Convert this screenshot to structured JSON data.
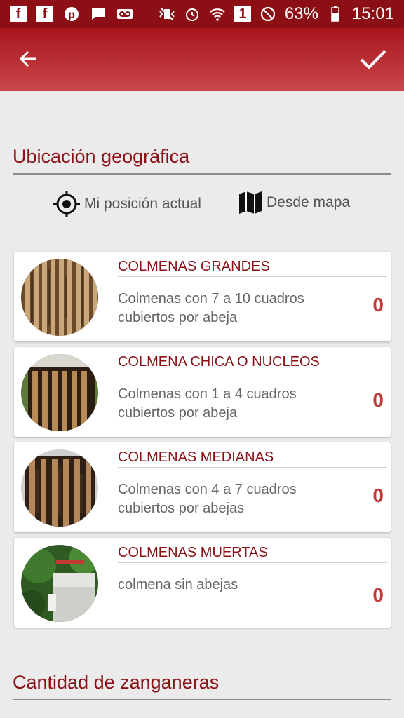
{
  "status_bar": {
    "battery": "63%",
    "time": "15:01",
    "sim": "1"
  },
  "app_bar": {
    "back_icon": "arrow-left-icon",
    "confirm_icon": "check-icon"
  },
  "location": {
    "title": "Ubicación geográfica",
    "current_position_label": "Mi posición actual",
    "from_map_label": "Desde mapa"
  },
  "hives": [
    {
      "title": "COLMENAS GRANDES",
      "description": "Colmenas con 7 a 10 cuadros cubiertos por abeja",
      "count": "0"
    },
    {
      "title": "COLMENA CHICA O NUCLEOS",
      "description": "Colmenas con 1 a 4 cuadros cubiertos por abeja",
      "count": "0"
    },
    {
      "title": "COLMENAS MEDIANAS",
      "description": "Colmenas con 4 a 7 cuadros cubiertos por abejas",
      "count": "0"
    },
    {
      "title": "COLMENAS MUERTAS",
      "description": "colmena sin abejas",
      "count": "0"
    }
  ],
  "drones": {
    "title": "Cantidad de zanganeras"
  },
  "colors": {
    "primary": "#8b0f14",
    "accent": "#c33a3a"
  }
}
